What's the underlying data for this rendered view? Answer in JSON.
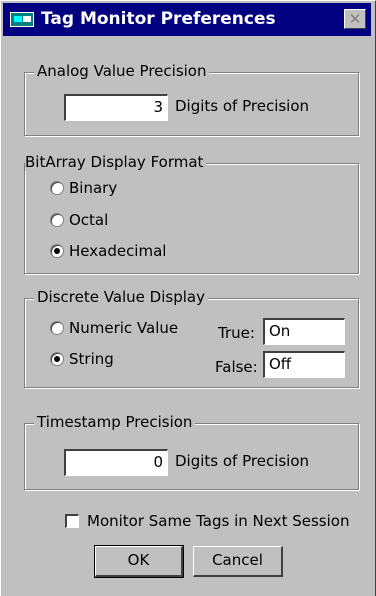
{
  "window": {
    "title": "Tag Monitor Preferences",
    "close_glyph": "✕"
  },
  "analog": {
    "legend": "Analog Value Precision",
    "value": "3",
    "suffix": "Digits of Precision"
  },
  "bitarray": {
    "legend": "BitArray Display Format",
    "options": [
      {
        "label": "Binary",
        "checked": false
      },
      {
        "label": "Octal",
        "checked": false
      },
      {
        "label": "Hexadecimal",
        "checked": true
      }
    ]
  },
  "discrete": {
    "legend": "Discrete Value Display",
    "options": [
      {
        "label": "Numeric Value",
        "checked": false
      },
      {
        "label": "String",
        "checked": true
      }
    ],
    "true_label": "True:",
    "true_value": "On",
    "false_label": "False:",
    "false_value": "Off"
  },
  "timestamp": {
    "legend": "Timestamp Precision",
    "value": "0",
    "suffix": "Digits of Precision"
  },
  "monitor_same_tags": {
    "label": "Monitor Same Tags in Next Session",
    "checked": false
  },
  "buttons": {
    "ok": "OK",
    "cancel": "Cancel"
  }
}
